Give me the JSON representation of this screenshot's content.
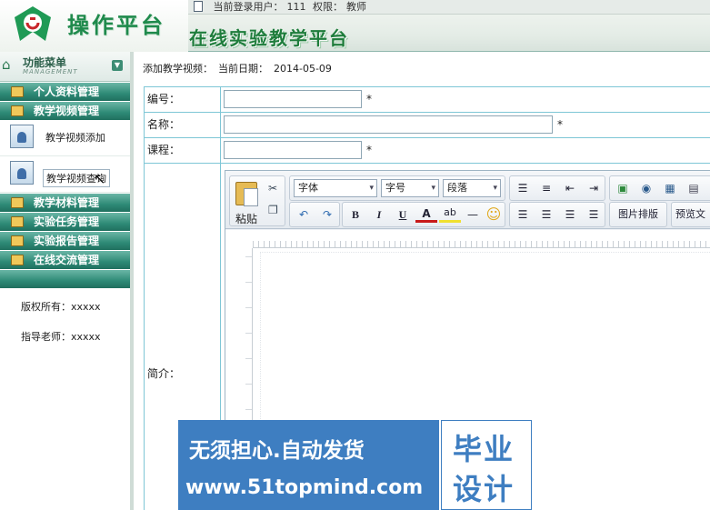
{
  "header": {
    "brand": "操作平台",
    "platform_title": "在线实验教学平台",
    "user_bar": {
      "user_label": "当前登录用户：",
      "user": "111",
      "perm_label": "权限：",
      "role": "教师"
    }
  },
  "sidebar": {
    "title": "功能菜单",
    "subtitle": "MANAGEMENT",
    "menu": [
      {
        "label": "个人资料管理"
      },
      {
        "label": "教学视频管理"
      }
    ],
    "subitems": [
      {
        "label": "教学视频添加"
      },
      {
        "label": "教学视频查询"
      }
    ],
    "menu2": [
      {
        "label": "教学材料管理"
      },
      {
        "label": "实验任务管理"
      },
      {
        "label": "实验报告管理"
      },
      {
        "label": "在线交流管理"
      }
    ],
    "copyright": "版权所有：xxxxx",
    "teacher": "指导老师：xxxxx"
  },
  "main": {
    "page_label": "添加教学视频：",
    "date_label": "当前日期：",
    "date": "2014-05-09",
    "fields": {
      "code_label": "编号：",
      "name_label": "名称：",
      "course_label": "课程：",
      "intro_label": "简介：",
      "required_mark": "*"
    },
    "editor": {
      "paste": "粘贴",
      "font": "字体",
      "size": "字号",
      "paragraph": "段落",
      "image_layout": "图片排版",
      "preview": "预览文"
    }
  },
  "watermark": {
    "line1": "无须担心.自动发货",
    "url": "www.51topmind.com",
    "right1": "毕业",
    "right2": "设计"
  }
}
